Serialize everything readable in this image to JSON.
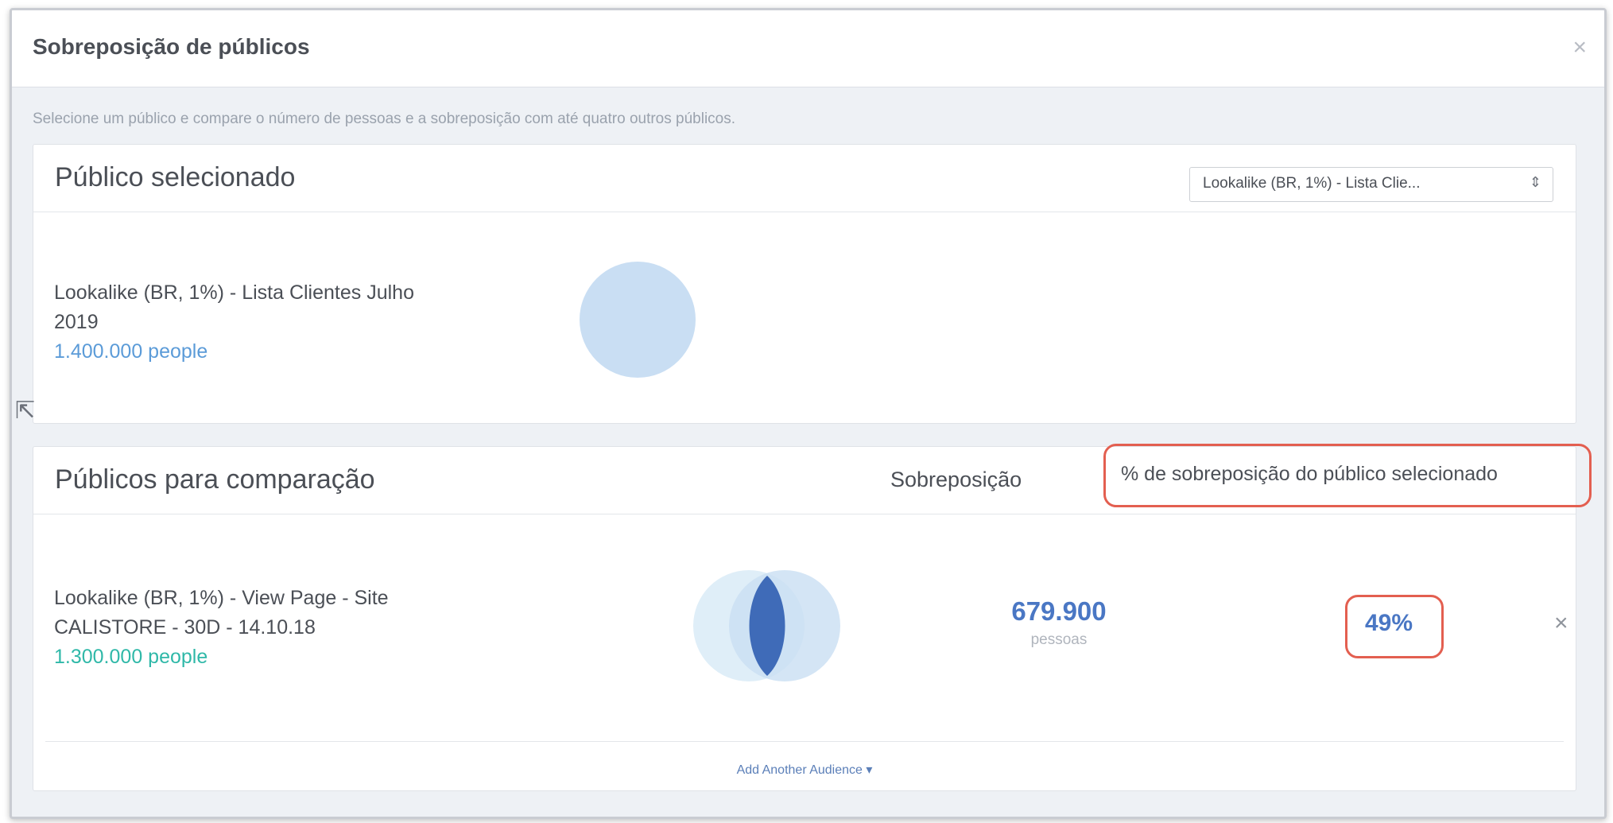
{
  "dialog": {
    "title": "Sobreposição de públicos",
    "close_glyph": "×",
    "subtitle": "Selecione um público e compare o número de pessoas e a sobreposição com até quatro outros públicos."
  },
  "selected": {
    "heading": "Público selecionado",
    "dropdown_value": "Lookalike (BR, 1%) - Lista Clie...",
    "dropdown_arrow": "⇕",
    "audience_name_line1": "Lookalike (BR, 1%) - Lista Clientes Julho",
    "audience_name_line2": "2019",
    "audience_count": "1.400.000 people"
  },
  "comparison": {
    "heading": "Públicos para comparação",
    "col_overlap": "Sobreposição",
    "col_percent": "% de sobreposição do público selecionado",
    "rows": [
      {
        "name_line1": "Lookalike (BR, 1%) - View Page - Site",
        "name_line2": "CALISTORE - 30D - 14.10.18",
        "count": "1.300.000 people",
        "overlap_value": "679.900",
        "overlap_unit": "pessoas",
        "overlap_percent": "49%",
        "remove_glyph": "×"
      }
    ],
    "add_another": "Add Another Audience ▾"
  },
  "colors": {
    "selected_circle": "#c9def3",
    "compare_circle": "#dcecf7",
    "overlap_lens": "#3f6bb8",
    "highlight_border": "#e35f50"
  },
  "icons": {
    "cursor": "mouse-pointer-icon"
  }
}
